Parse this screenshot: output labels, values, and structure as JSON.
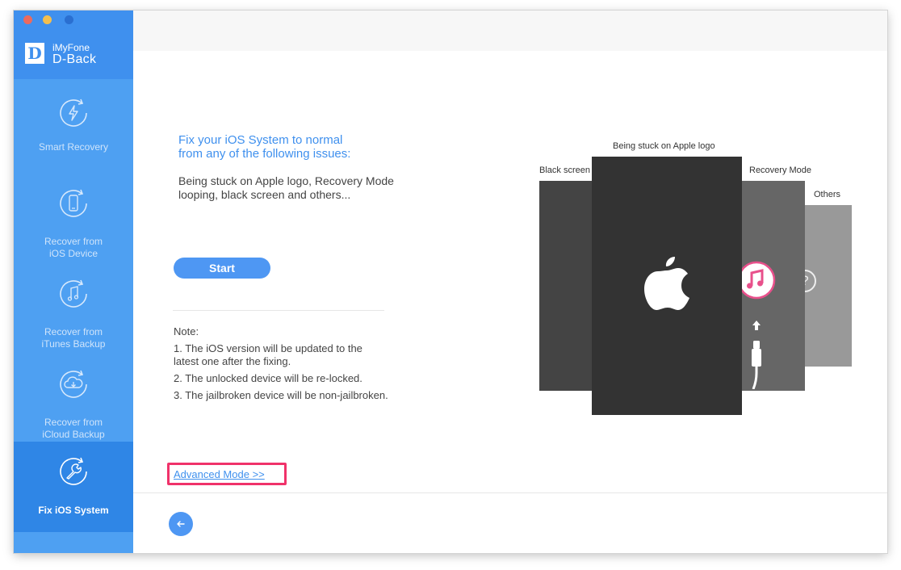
{
  "app": {
    "brand_small": "iMyFone",
    "brand_big": "D-Back",
    "logo_letter": "D"
  },
  "sidebar": {
    "items": [
      {
        "line1": "Smart Recovery",
        "line2": "",
        "icon": "lightning-refresh-icon"
      },
      {
        "line1": "Recover from",
        "line2": "iOS Device",
        "icon": "phone-refresh-icon"
      },
      {
        "line1": "Recover from",
        "line2": "iTunes Backup",
        "icon": "music-refresh-icon"
      },
      {
        "line1": "Recover from",
        "line2": "iCloud Backup",
        "icon": "cloud-refresh-icon"
      },
      {
        "line1": "Fix iOS System",
        "line2": "",
        "icon": "wrench-refresh-icon",
        "active": true
      }
    ]
  },
  "main": {
    "heading_line1": "Fix your iOS System to normal",
    "heading_line2": "from any of the following issues:",
    "issues_text": "Being stuck on Apple logo, Recovery Mode looping, black screen and others...",
    "start_label": "Start",
    "note_title": "Note:",
    "notes": [
      "1. The iOS version will be updated to the latest one after the fixing.",
      "2. The unlocked device will be re-locked.",
      "3. The jailbroken device will be non-jailbroken."
    ],
    "advanced_link": "Advanced Mode >>"
  },
  "illustration": {
    "label_black_screen": "Black screen",
    "label_apple_logo": "Being stuck on Apple logo",
    "label_recovery": "Recovery Mode",
    "label_others": "Others",
    "others_symbol": "?"
  },
  "colors": {
    "sidebar": "#4ea0f2",
    "sidebar_active": "#2f86e6",
    "accent": "#3f90ee",
    "highlight_box": "#f0326a"
  }
}
